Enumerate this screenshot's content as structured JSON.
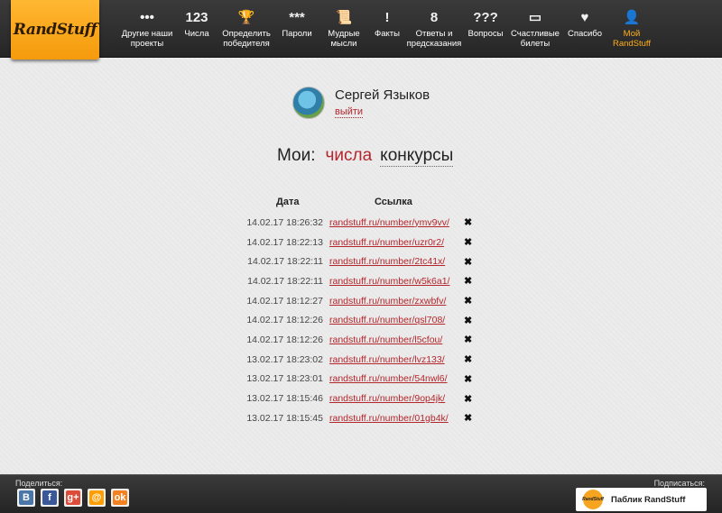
{
  "logo": {
    "text": "RandStuff"
  },
  "nav": [
    {
      "icon": "•••",
      "label": "Другие наши\nпроекты",
      "icon_name": "dots-icon"
    },
    {
      "icon": "123",
      "label": "Числа",
      "icon_name": "numbers-icon"
    },
    {
      "icon": "🏆",
      "label": "Определить\nпобедителя",
      "icon_name": "trophy-icon"
    },
    {
      "icon": "***",
      "label": "Пароли",
      "icon_name": "asterisks-icon"
    },
    {
      "icon": "📜",
      "label": "Мудрые\nмысли",
      "icon_name": "scroll-icon"
    },
    {
      "icon": "!",
      "label": "Факты",
      "icon_name": "exclamation-icon"
    },
    {
      "icon": "8",
      "label": "Ответы и\nпредсказания",
      "icon_name": "magic-ball-icon"
    },
    {
      "icon": "???",
      "label": "Вопросы",
      "icon_name": "question-icon"
    },
    {
      "icon": "▭",
      "label": "Счастливые\nбилеты",
      "icon_name": "ticket-icon"
    },
    {
      "icon": "♥",
      "label": "Спасибо",
      "icon_name": "heart-icon"
    },
    {
      "icon": "👤",
      "label": "Мой\nRandStuff",
      "icon_name": "user-icon"
    }
  ],
  "profile": {
    "name": "Сергей Языков",
    "logout": "выйти"
  },
  "tabs": {
    "prefix": "Мои:",
    "numbers": "числа",
    "contests": "конкурсы"
  },
  "table": {
    "date_header": "Дата",
    "link_header": "Ссылка",
    "rows": [
      {
        "date": "14.02.17 18:26:32",
        "link": "randstuff.ru/number/ymv9vv/"
      },
      {
        "date": "14.02.17 18:22:13",
        "link": "randstuff.ru/number/uzr0r2/"
      },
      {
        "date": "14.02.17 18:22:11",
        "link": "randstuff.ru/number/2tc41x/"
      },
      {
        "date": "14.02.17 18:22:11",
        "link": "randstuff.ru/number/w5k6a1/"
      },
      {
        "date": "14.02.17 18:12:27",
        "link": "randstuff.ru/number/zxwbfv/"
      },
      {
        "date": "14.02.17 18:12:26",
        "link": "randstuff.ru/number/qsl708/"
      },
      {
        "date": "14.02.17 18:12:26",
        "link": "randstuff.ru/number/l5cfou/"
      },
      {
        "date": "13.02.17 18:23:02",
        "link": "randstuff.ru/number/lvz133/"
      },
      {
        "date": "13.02.17 18:23:01",
        "link": "randstuff.ru/number/54nwl6/"
      },
      {
        "date": "13.02.17 18:15:46",
        "link": "randstuff.ru/number/9op4jk/"
      },
      {
        "date": "13.02.17 18:15:45",
        "link": "randstuff.ru/number/01gb4k/"
      }
    ],
    "delete_symbol": "✖"
  },
  "footer": {
    "share_label": "Поделиться:",
    "subscribe_label": "Подписаться:",
    "share_buttons": [
      {
        "glyph": "B",
        "name": "vk-share-button",
        "cls": "vk"
      },
      {
        "glyph": "f",
        "name": "facebook-share-button",
        "cls": "fb"
      },
      {
        "glyph": "g+",
        "name": "google-plus-share-button",
        "cls": "gp"
      },
      {
        "glyph": "@",
        "name": "mail-share-button",
        "cls": "mail"
      },
      {
        "glyph": "ok",
        "name": "odnoklassniki-share-button",
        "cls": "ok"
      }
    ],
    "public_button": "Паблик RandStuff",
    "public_logo_text": "RandStuff"
  },
  "colors": {
    "accent": "#f7a521",
    "link": "#b3262c",
    "topbar": "#2e2e2e"
  }
}
